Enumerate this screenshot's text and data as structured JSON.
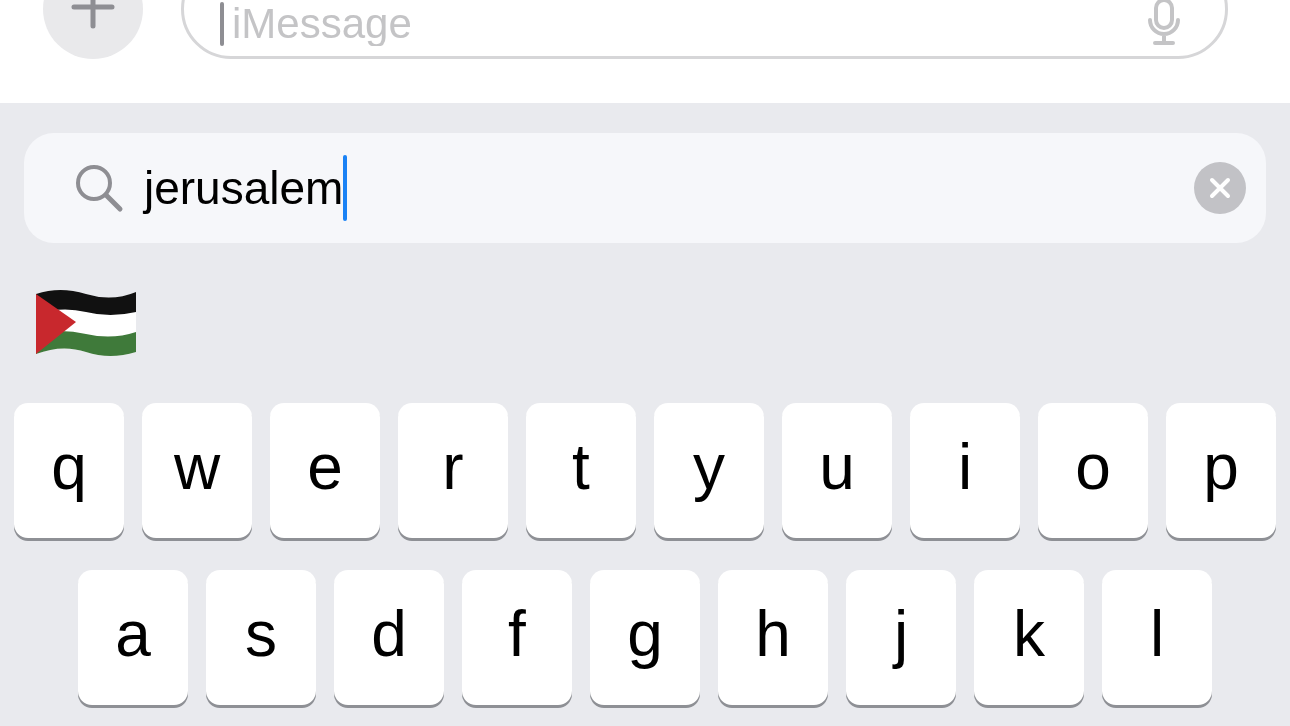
{
  "message_bar": {
    "placeholder": "iMessage"
  },
  "emoji_search": {
    "value": "jerusalem"
  },
  "results": [
    {
      "kind": "flag"
    }
  ],
  "keyboard": {
    "rows": [
      [
        "q",
        "w",
        "e",
        "r",
        "t",
        "y",
        "u",
        "i",
        "o",
        "p"
      ],
      [
        "a",
        "s",
        "d",
        "f",
        "g",
        "h",
        "j",
        "k",
        "l"
      ]
    ]
  }
}
